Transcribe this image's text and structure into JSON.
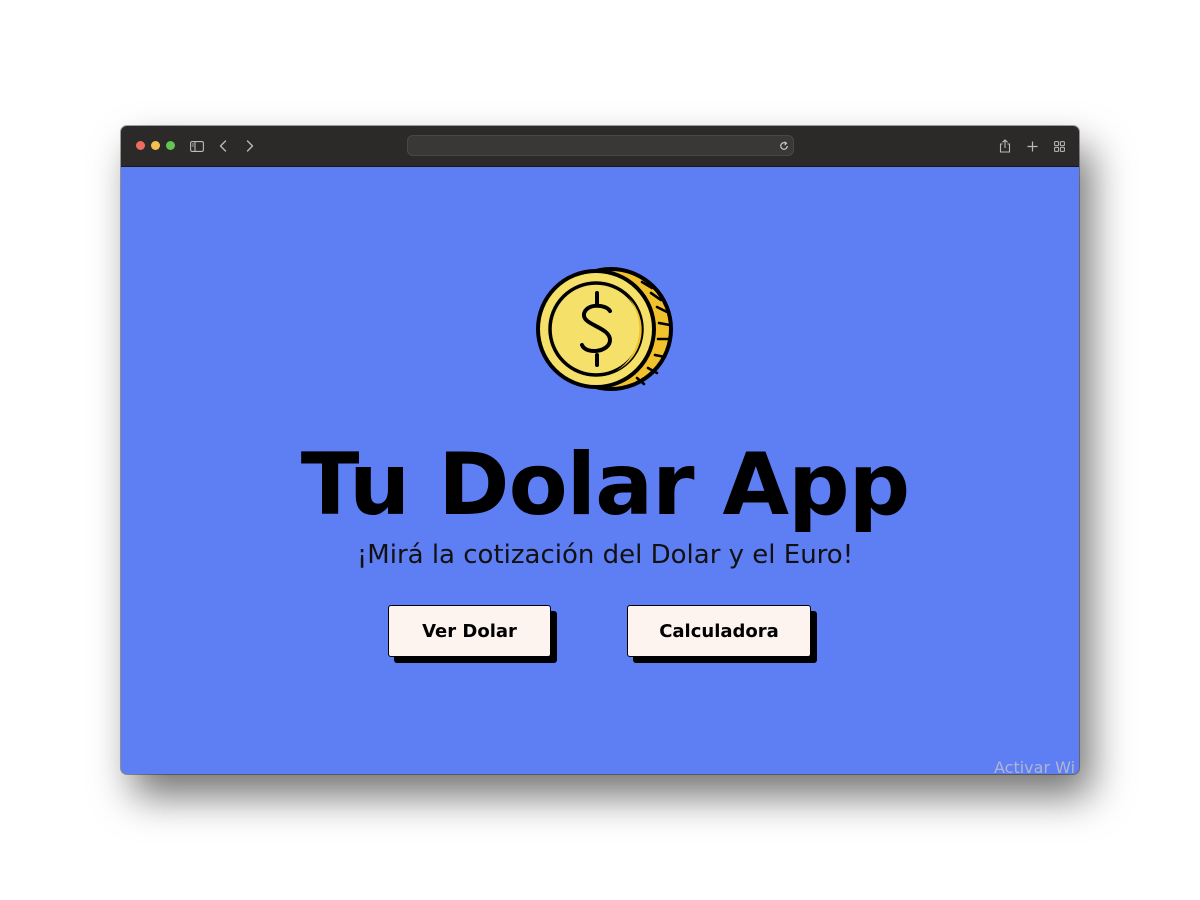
{
  "browser": {
    "address": "",
    "icons": [
      "sidebar-icon",
      "back-icon",
      "forward-icon",
      "reload-icon",
      "share-icon",
      "new-tab-icon",
      "tab-overview-icon"
    ]
  },
  "page": {
    "logo_icon": "dollar-coin-icon",
    "title": "Tu Dolar App",
    "subtitle": "¡Mirá la cotización del Dolar y el Euro!",
    "buttons": {
      "ver_dolar": "Ver Dolar",
      "calculadora": "Calculadora"
    }
  },
  "watermark": "Activar Wi",
  "colors": {
    "background": "#5e7ef4",
    "titlebar": "#2c2a29",
    "button_bg": "#fdf3ef",
    "coin_gold": "#f5e06a",
    "coin_dark_gold": "#f2c22c"
  }
}
